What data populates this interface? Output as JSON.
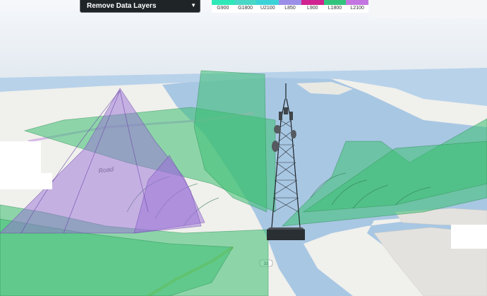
{
  "layer_selector": {
    "selected": "Remove Data Layers"
  },
  "legend": {
    "items": [
      {
        "label": "G900",
        "color": "#2ee8b8"
      },
      {
        "label": "G1800",
        "color": "#49d7c6"
      },
      {
        "label": "U2100",
        "color": "#3bd3d7"
      },
      {
        "label": "L850",
        "color": "#9b8ee8"
      },
      {
        "label": "L900",
        "color": "#d0238f"
      },
      {
        "label": "L1800",
        "color": "#33c47c"
      },
      {
        "label": "L2100",
        "color": "#c376e0"
      }
    ]
  },
  "map": {
    "road_labels": [
      "Road"
    ],
    "route_shield": "33"
  },
  "colors": {
    "green_sector": "#3cbf72",
    "purple_sector": "#9a6fd8",
    "water": "#a9c8e4",
    "land": "#f1f1ee"
  }
}
